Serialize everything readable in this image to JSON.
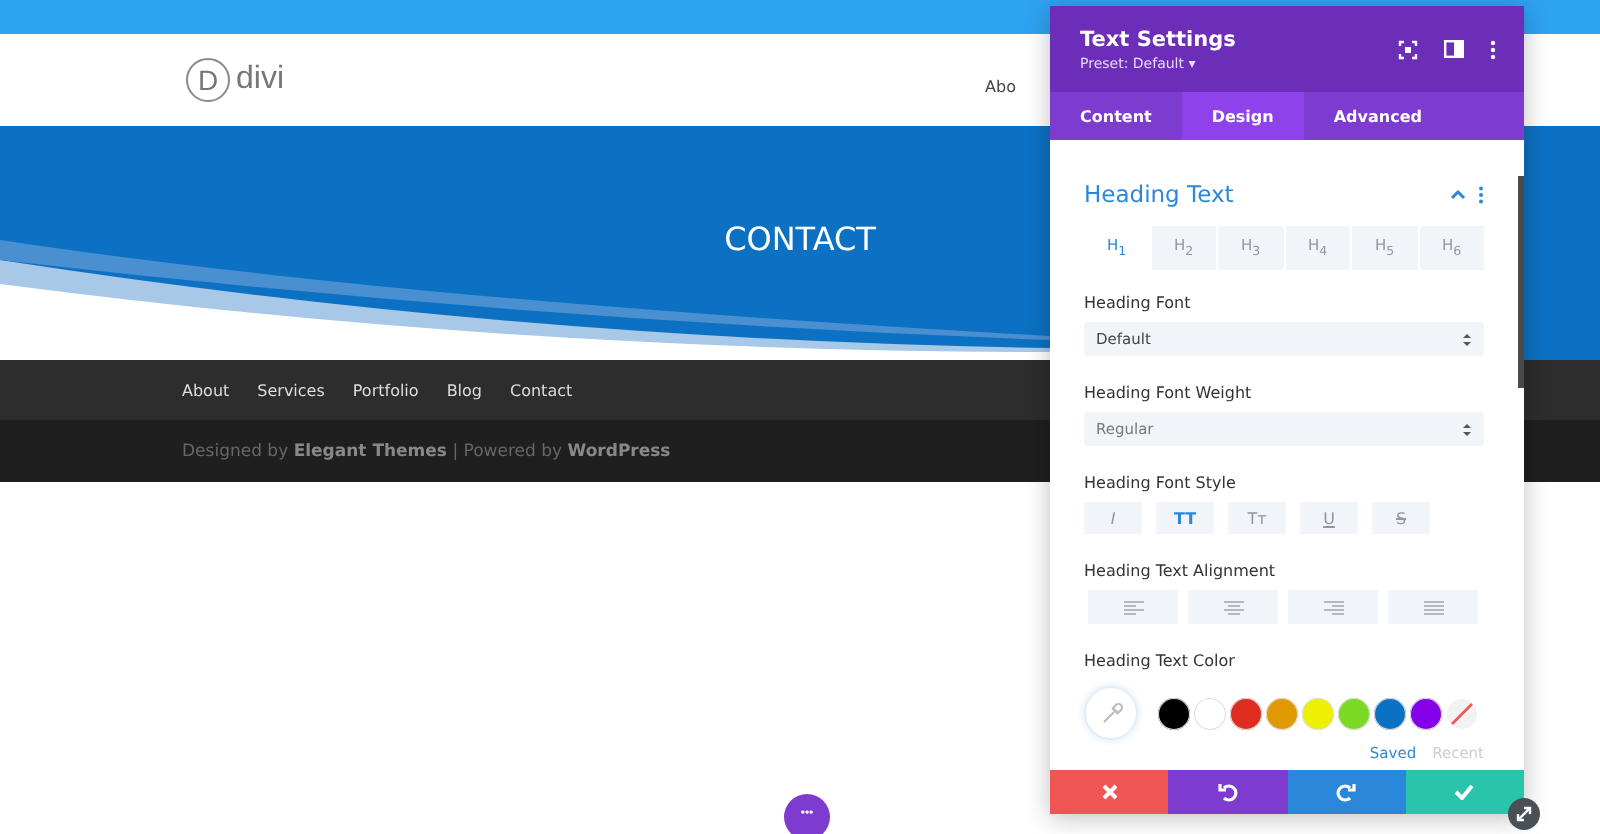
{
  "site": {
    "logo_letter": "D",
    "logo_text": "divi",
    "header_nav": [
      "Abo"
    ],
    "hero_title": "CONTACT",
    "footer_nav": [
      "About",
      "Services",
      "Portfolio",
      "Blog",
      "Contact"
    ],
    "credits": "Designed by **Elegant Themes** | Powered by **WordPress**",
    "more_button": "•••"
  },
  "panel": {
    "title": "Text Settings",
    "preset": "Preset: Default ▾",
    "tabs": [
      {
        "label": "Content",
        "selected": false
      },
      {
        "label": "Design",
        "selected": true
      },
      {
        "label": "Advanced",
        "selected": false
      }
    ],
    "section": {
      "title": "Heading Text",
      "expanded": true
    },
    "heading_levels": [
      {
        "label": "H$_{1}$",
        "selected": true
      },
      {
        "label": "H$_{2}$",
        "selected": false
      },
      {
        "label": "H$_{3}$",
        "selected": false
      },
      {
        "label": "H$_{4}$",
        "selected": false
      },
      {
        "label": "H$_{5}$",
        "selected": false
      },
      {
        "label": "H$_{6}$",
        "selected": false
      }
    ],
    "heading_font": {
      "label": "Heading Font",
      "value": "Default"
    },
    "heading_font_weight": {
      "label": "Heading Font Weight",
      "value": "Regular"
    },
    "font_style": {
      "label": "Heading Font Style",
      "options": [
        {
          "kind": "italic",
          "label": "I",
          "selected": false
        },
        {
          "kind": "uppercase",
          "label": "TT",
          "selected": true
        },
        {
          "kind": "smallcaps",
          "label": "Tт",
          "selected": false
        },
        {
          "kind": "underline",
          "label": "U",
          "selected": false
        },
        {
          "kind": "strike",
          "label": "S",
          "selected": false
        }
      ]
    },
    "alignment": {
      "label": "Heading Text Alignment",
      "options": [
        {
          "kind": "left",
          "selected": false
        },
        {
          "kind": "center",
          "selected": false
        },
        {
          "kind": "right",
          "selected": false
        },
        {
          "kind": "justify",
          "selected": false
        }
      ]
    },
    "text_color": {
      "label": "Heading Text Color",
      "swatches": [
        {
          "kind": "color",
          "color": "#000000"
        },
        {
          "kind": "color",
          "color": "#ffffff"
        },
        {
          "kind": "color",
          "color": "#e02b20"
        },
        {
          "kind": "color",
          "color": "#e09900"
        },
        {
          "kind": "color",
          "color": "#edf000"
        },
        {
          "kind": "color",
          "color": "#7cda24"
        },
        {
          "kind": "color",
          "color": "#0c71c3"
        },
        {
          "kind": "color",
          "color": "#8300e9"
        },
        {
          "kind": "none"
        }
      ],
      "palette_tabs": [
        {
          "label": "Saved",
          "selected": true
        },
        {
          "label": "Recent",
          "selected": false
        }
      ]
    },
    "actions": [
      {
        "kind": "cancel"
      },
      {
        "kind": "undo"
      },
      {
        "kind": "redo"
      },
      {
        "kind": "save"
      }
    ]
  }
}
